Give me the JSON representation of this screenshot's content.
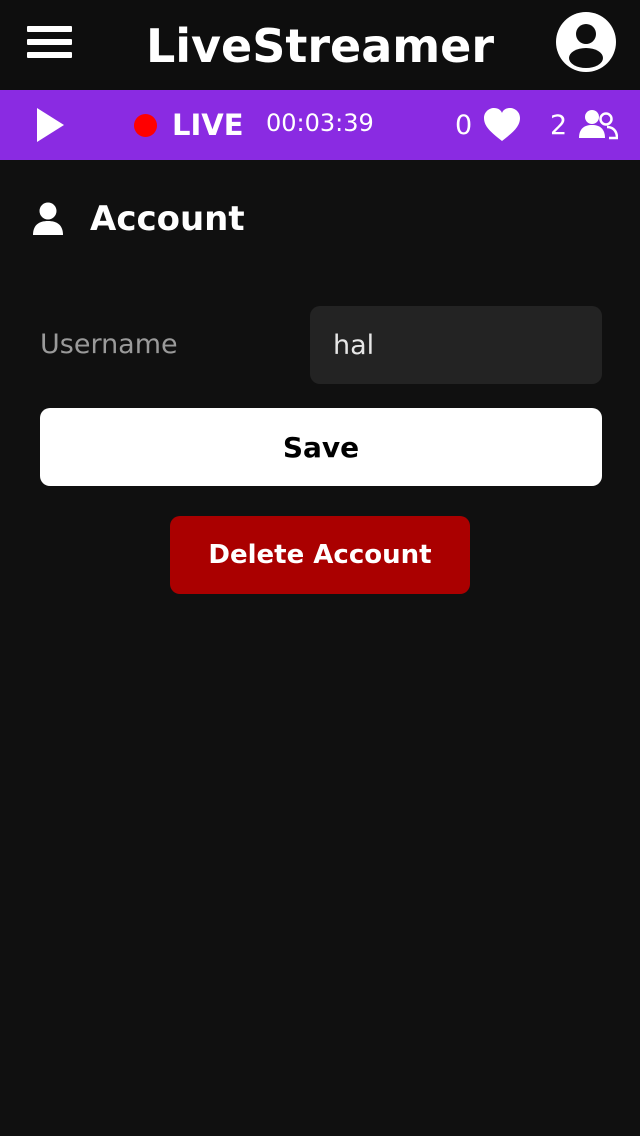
{
  "header": {
    "title": "LiveStreamer",
    "menu_icon": "hamburger-menu-icon",
    "profile_icon": "user-circle-icon"
  },
  "live_bar": {
    "play_icon": "play-icon",
    "status": "LIVE",
    "status_dot_color": "#ff0000",
    "timer": "00:03:39",
    "likes": "0",
    "likes_icon": "heart-icon",
    "viewers": "2",
    "viewers_icon": "users-icon",
    "background_color": "#8a2be2"
  },
  "account": {
    "icon": "user-icon",
    "title": "Account",
    "username_label": "Username",
    "username_value": "hal",
    "save_label": "Save",
    "delete_label": "Delete Account",
    "delete_color": "#aa0000"
  }
}
